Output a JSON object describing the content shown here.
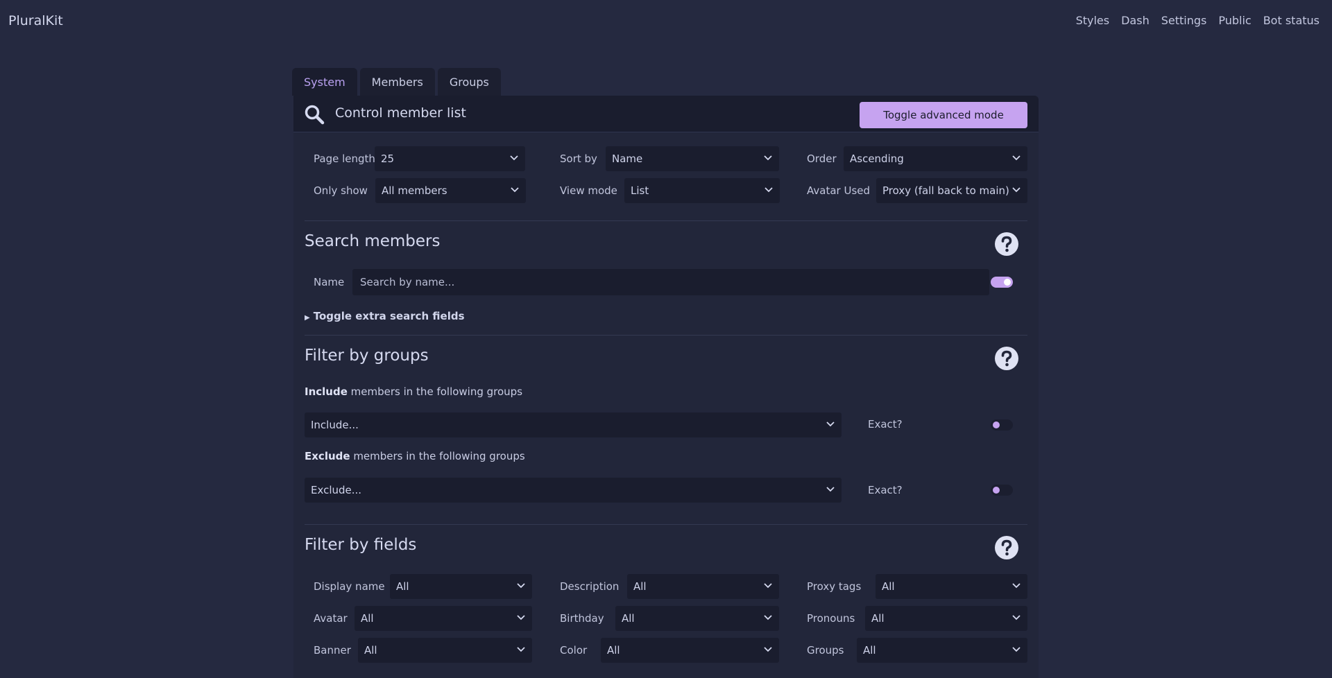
{
  "app": {
    "brand": "PluralKit"
  },
  "nav": [
    "Styles",
    "Dash",
    "Settings",
    "Public",
    "Bot status"
  ],
  "tabs": [
    "System",
    "Members",
    "Groups"
  ],
  "header": {
    "title": "Control member list",
    "advanced_button": "Toggle advanced mode"
  },
  "controls": {
    "page_length": {
      "label": "Page length",
      "value": "25"
    },
    "sort_by": {
      "label": "Sort by",
      "value": "Name"
    },
    "order": {
      "label": "Order",
      "value": "Ascending"
    },
    "only_show": {
      "label": "Only show",
      "value": "All members"
    },
    "view_mode": {
      "label": "View mode",
      "value": "List"
    },
    "avatar_used": {
      "label": "Avatar Used",
      "value": "Proxy (fall back to main)"
    }
  },
  "search": {
    "title": "Search members",
    "name_label": "Name",
    "name_placeholder": "Search by name...",
    "name_toggle_on": true,
    "extra_fields": "Toggle extra search fields"
  },
  "groups_filter": {
    "title": "Filter by groups",
    "include_bold": "Include",
    "include_rest": " members in the following groups",
    "include_placeholder": "Include...",
    "exclude_bold": "Exclude",
    "exclude_rest": " members in the following groups",
    "exclude_placeholder": "Exclude...",
    "exact_label": "Exact?"
  },
  "fields_filter": {
    "title": "Filter by fields",
    "display_name": {
      "label": "Display name",
      "value": "All"
    },
    "description": {
      "label": "Description",
      "value": "All"
    },
    "proxy_tags": {
      "label": "Proxy tags",
      "value": "All"
    },
    "avatar": {
      "label": "Avatar",
      "value": "All"
    },
    "birthday": {
      "label": "Birthday",
      "value": "All"
    },
    "pronouns": {
      "label": "Pronouns",
      "value": "All"
    },
    "banner": {
      "label": "Banner",
      "value": "All"
    },
    "color": {
      "label": "Color",
      "value": "All"
    },
    "groups": {
      "label": "Groups",
      "value": "All"
    }
  },
  "colors": {
    "background": "#252940",
    "card": "#22263a",
    "accent": "#c6a3f0"
  }
}
